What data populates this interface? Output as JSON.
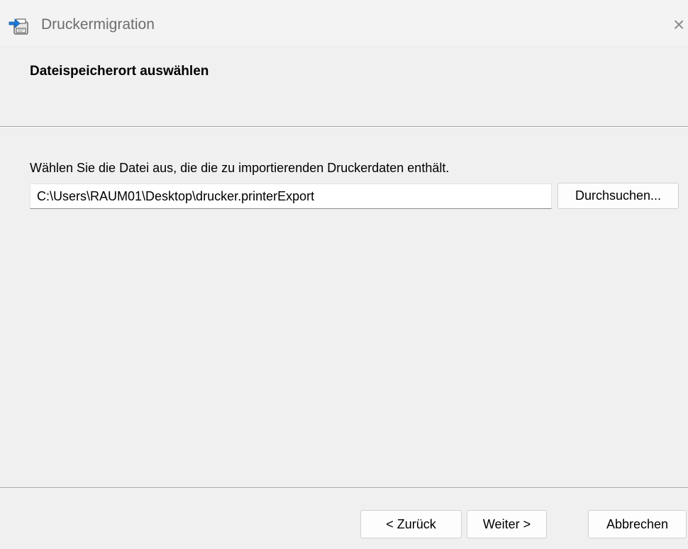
{
  "window": {
    "title": "Druckermigration",
    "icon": "printer-migration-icon",
    "close_glyph": "×"
  },
  "header": {
    "title": "Dateispeicherort auswählen"
  },
  "main": {
    "instruction": "Wählen Sie die Datei aus, die die zu importierenden Druckerdaten enthält.",
    "file_path_value": "C:\\Users\\RAUM01\\Desktop\\drucker.printerExport",
    "browse_label": "Durchsuchen..."
  },
  "footer": {
    "back_label": "< Zurück",
    "next_label": "Weiter >",
    "cancel_label": "Abbrechen"
  },
  "colors": {
    "background": "#f0f0f0",
    "title_text": "#6d6d6d",
    "icon_accent": "#1e7ad6"
  }
}
